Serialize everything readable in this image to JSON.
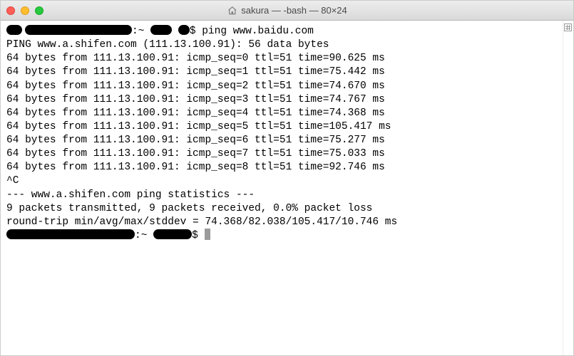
{
  "window": {
    "title": "sakura — -bash — 80×24"
  },
  "terminal": {
    "prompt1_cmd": "ping www.baidu.com",
    "prompt1_host_sep": ":~",
    "prompt1_dollar": "$",
    "ping_header": "PING www.a.shifen.com (111.13.100.91): 56 data bytes",
    "replies": [
      "64 bytes from 111.13.100.91: icmp_seq=0 ttl=51 time=90.625 ms",
      "64 bytes from 111.13.100.91: icmp_seq=1 ttl=51 time=75.442 ms",
      "64 bytes from 111.13.100.91: icmp_seq=2 ttl=51 time=74.670 ms",
      "64 bytes from 111.13.100.91: icmp_seq=3 ttl=51 time=74.767 ms",
      "64 bytes from 111.13.100.91: icmp_seq=4 ttl=51 time=74.368 ms",
      "64 bytes from 111.13.100.91: icmp_seq=5 ttl=51 time=105.417 ms",
      "64 bytes from 111.13.100.91: icmp_seq=6 ttl=51 time=75.277 ms",
      "64 bytes from 111.13.100.91: icmp_seq=7 ttl=51 time=75.033 ms",
      "64 bytes from 111.13.100.91: icmp_seq=8 ttl=51 time=92.746 ms"
    ],
    "interrupt": "^C",
    "stats_header": "--- www.a.shifen.com ping statistics ---",
    "stats_line1": "9 packets transmitted, 9 packets received, 0.0% packet loss",
    "stats_line2": "round-trip min/avg/max/stddev = 74.368/82.038/105.417/10.746 ms",
    "prompt2_dollar": "$"
  }
}
